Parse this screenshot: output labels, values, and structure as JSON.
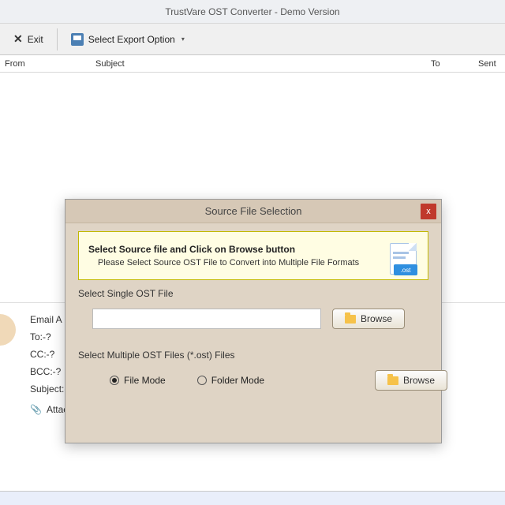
{
  "window": {
    "title": "TrustVare OST Converter - Demo Version"
  },
  "toolbar": {
    "exit_label": "Exit",
    "export_label": "Select Export Option"
  },
  "columns": {
    "from": "From",
    "subject": "Subject",
    "to": "To",
    "sent": "Sent"
  },
  "detail": {
    "email": "Email A",
    "to": "To:-?",
    "cc": "CC:-?",
    "bcc": "BCC:-?",
    "subject": "Subject:-?",
    "attachments": "Attachments:-?"
  },
  "dialog": {
    "title": "Source File Selection",
    "close": "x",
    "info_title": "Select Source file and Click on Browse button",
    "info_sub": "Please Select Source OST File to Convert into Multiple File Formats",
    "ost_ext": ".ost",
    "section_single": "Select Single OST File",
    "single_value": "",
    "browse_label": "Browse",
    "section_multi": "Select Multiple OST Files (*.ost) Files",
    "radio_file": "File Mode",
    "radio_folder": "Folder Mode",
    "selected_mode": "file"
  }
}
